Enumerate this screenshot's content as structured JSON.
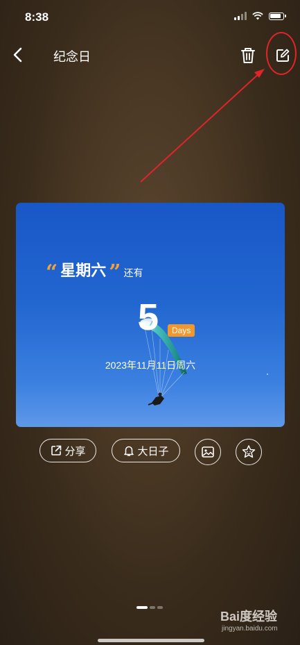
{
  "status_bar": {
    "time": "8:38"
  },
  "nav": {
    "title": "纪念日",
    "back_icon": "chevron-left-icon",
    "delete_icon": "trash-icon",
    "edit_icon": "edit-icon"
  },
  "card": {
    "weekday": "星期六",
    "remaining_label": "还有",
    "day_count": "5",
    "days_unit": "Days",
    "target_date": "2023年11月11日周六"
  },
  "actions": {
    "share_label": "分享",
    "bigday_label": "大日子",
    "share_icon": "share-icon",
    "bigday_icon": "bell-icon",
    "image_icon": "image-icon",
    "sticker_icon": "sticker-icon"
  },
  "pager": {
    "total_pages": 3,
    "active_page": 1
  },
  "watermark": {
    "brand": "Bai度经验",
    "url": "jingyan.baidu.com"
  },
  "colors": {
    "quote_accent": "#f2a23a",
    "badge": "#f0982e",
    "annotation_red": "#e0252a"
  }
}
